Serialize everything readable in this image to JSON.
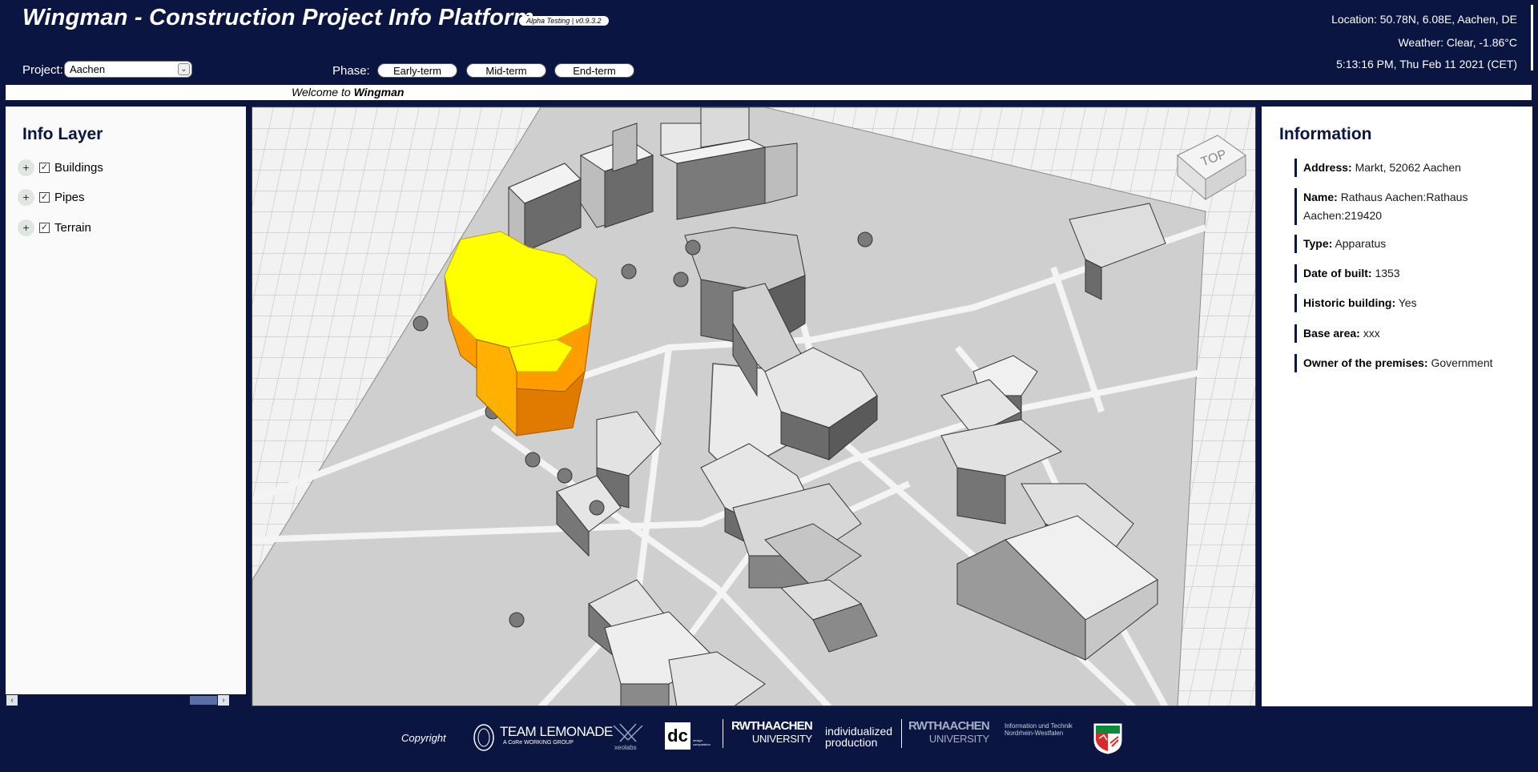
{
  "header": {
    "title": "Wingman - Construction Project Info Platform",
    "version": "Alpha Testing | v0.9.3.2",
    "project_label": "Project:",
    "project_value": "Aachen",
    "phase_label": "Phase:",
    "phases": [
      "Early-term",
      "Mid-term",
      "End-term"
    ],
    "location": "Location: 50.78N, 6.08E, Aachen, DE",
    "weather": "Weather: Clear, -1.86°C",
    "time": "5:13:16 PM, Thu Feb 11 2021 (CET)"
  },
  "welcome": {
    "prefix": "Welcome to",
    "name": "Wingman"
  },
  "info_layer": {
    "title": "Info Layer",
    "items": [
      {
        "label": "Buildings",
        "checked": true
      },
      {
        "label": "Pipes",
        "checked": true
      },
      {
        "label": "Terrain",
        "checked": true
      }
    ]
  },
  "map": {
    "nav_cube_label": "TOP",
    "highlight_color": "#ffff00",
    "highlight_side_color": "#ff9d00"
  },
  "information": {
    "title": "Information",
    "rows": [
      {
        "key": "Address:",
        "value": "Markt, 52062 Aachen"
      },
      {
        "key": "Name:",
        "value": "Rathaus Aachen:Rathaus Aachen:219420"
      },
      {
        "key": "Type:",
        "value": "Apparatus"
      },
      {
        "key": "Date of built:",
        "value": "1353"
      },
      {
        "key": "Historic building:",
        "value": "Yes"
      },
      {
        "key": "Base area:",
        "value": "xxx"
      },
      {
        "key": "Owner of the premises:",
        "value": "Government"
      }
    ]
  },
  "footer": {
    "copyright": "Copyright",
    "logos": {
      "team_lemonade": "TEAM LEMONADE",
      "team_lemonade_sub": "A CoRe WORKING GROUP",
      "xeolabs": "xeolabs",
      "dc": "dc",
      "dc_sub": "design computation",
      "rwth1_top": "RWTHAACHEN",
      "rwth1_bottom": "UNIVERSITY",
      "indiv_top": "individualized",
      "indiv_bottom": "production",
      "rwth2_top": "RWTHAACHEN",
      "rwth2_bottom": "UNIVERSITY",
      "nrw_top": "Information und Technik",
      "nrw_bottom": "Nordrhein-Westfalen"
    }
  }
}
